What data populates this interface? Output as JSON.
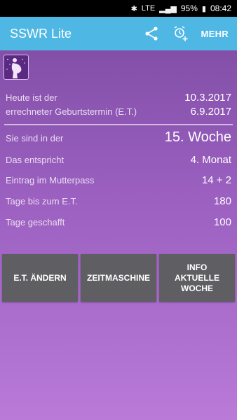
{
  "status_bar": {
    "battery": "95%",
    "time": "08:42",
    "network": "LTE"
  },
  "app_bar": {
    "title": "SSWR Lite",
    "share_icon": "share-icon",
    "alarm_icon": "alarm-add-icon",
    "more_label": "MEHR"
  },
  "info": {
    "today_label": "Heute ist der",
    "today_value": "10.3.2017",
    "due_label": "errechneter Geburtstermin (E.T.)",
    "due_value": "6.9.2017",
    "week_label": "Sie sind in der",
    "week_value": "15. Woche",
    "month_label": "Das entspricht",
    "month_value": "4. Monat",
    "pass_label": "Eintrag im Mutterpass",
    "pass_value": "14 + 2",
    "days_left_label": "Tage bis zum E.T.",
    "days_left_value": "180",
    "days_done_label": "Tage geschafft",
    "days_done_value": "100"
  },
  "buttons": {
    "change_due": "E.T. ÄNDERN",
    "time_machine": "ZEITMASCHINE",
    "info_week": "INFO\nAKTUELLE\nWOCHE"
  }
}
